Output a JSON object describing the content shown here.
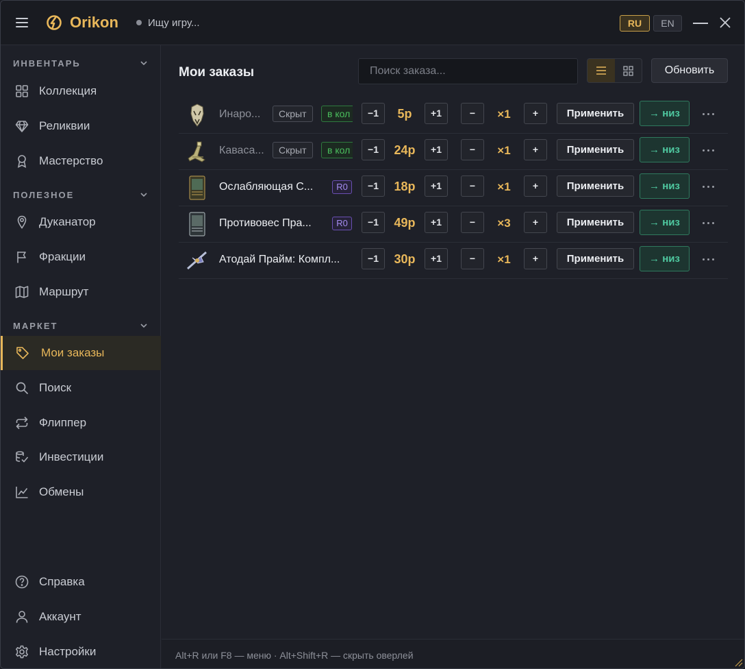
{
  "header": {
    "app_title": "Orikon",
    "status_text": "Ищу игру...",
    "lang_ru": "RU",
    "lang_en": "EN"
  },
  "sidebar": {
    "sections": [
      {
        "label": "ИНВЕНТАРЬ",
        "items": [
          {
            "label": "Коллекция",
            "icon": "grid-icon"
          },
          {
            "label": "Реликвии",
            "icon": "diamond-icon"
          },
          {
            "label": "Мастерство",
            "icon": "medal-icon"
          }
        ]
      },
      {
        "label": "ПОЛЕЗНОЕ",
        "items": [
          {
            "label": "Дуканатор",
            "icon": "pin-icon"
          },
          {
            "label": "Фракции",
            "icon": "flag-icon"
          },
          {
            "label": "Маршрут",
            "icon": "map-icon"
          }
        ]
      },
      {
        "label": "МАРКЕТ",
        "items": [
          {
            "label": "Мои заказы",
            "icon": "tag-icon",
            "active": true
          },
          {
            "label": "Поиск",
            "icon": "search-icon"
          },
          {
            "label": "Флиппер",
            "icon": "repeat-icon"
          },
          {
            "label": "Инвестиции",
            "icon": "coins-icon"
          },
          {
            "label": "Обмены",
            "icon": "chart-icon"
          }
        ]
      }
    ],
    "bottom": [
      {
        "label": "Справка",
        "icon": "help-icon"
      },
      {
        "label": "Аккаунт",
        "icon": "user-icon"
      },
      {
        "label": "Настройки",
        "icon": "gear-icon"
      }
    ]
  },
  "main": {
    "title": "Мои заказы",
    "search_placeholder": "Поиск заказа...",
    "refresh_label": "Обновить",
    "view_mode": "list"
  },
  "controls": {
    "minus_one": "−1",
    "plus_one": "+1",
    "minus": "−",
    "plus": "+",
    "apply": "Применить",
    "move_down": "→ низ"
  },
  "orders": [
    {
      "name": "Инаро...",
      "hidden_badge": "Скрыт",
      "collection_badge": "в кол",
      "price": "5р",
      "qty": "×1",
      "dim": true
    },
    {
      "name": "Каваса...",
      "hidden_badge": "Скрыт",
      "collection_badge": "в кол",
      "price": "24р",
      "qty": "×1",
      "dim": true
    },
    {
      "name": "Ослабляющая С...",
      "rank_badge": "R0",
      "price": "18р",
      "qty": "×1"
    },
    {
      "name": "Противовес Пра...",
      "rank_badge": "R0",
      "price": "49р",
      "qty": "×3"
    },
    {
      "name": "Атодай Прайм: Компл...",
      "price": "30р",
      "qty": "×1"
    }
  ],
  "footer": {
    "hint": "Alt+R или F8 — меню · Alt+Shift+R — скрыть оверлей"
  },
  "colors": {
    "accent": "#e8b75a",
    "background": "#1e2028",
    "green": "#4bbf5e",
    "teal": "#4fc9a0",
    "purple": "#a58cf0"
  }
}
